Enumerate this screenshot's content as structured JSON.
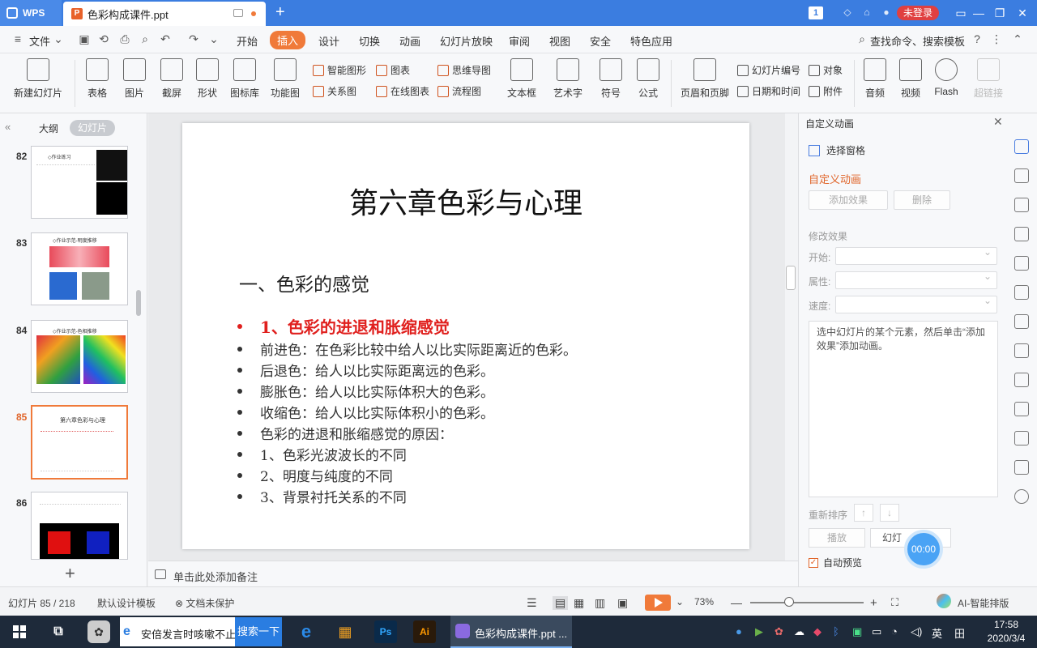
{
  "titlebar": {
    "app_tab": "WPS",
    "doc_tab": "色彩构成课件.ppt",
    "new_tab": "+",
    "page_badge": "1",
    "login": "未登录"
  },
  "menubar": {
    "file": "文件",
    "items": [
      "开始",
      "插入",
      "设计",
      "切换",
      "动画",
      "幻灯片放映",
      "审阅",
      "视图",
      "安全",
      "特色应用"
    ],
    "search": "查找命令、搜索模板"
  },
  "ribbon": {
    "new_slide": "新建幻灯片",
    "table": "表格",
    "picture": "图片",
    "screenshot": "截屏",
    "shape": "形状",
    "icon_lib": "图标库",
    "func_chart": "功能图",
    "smart_shape": "智能图形",
    "chart": "图表",
    "mind_map": "思维导图",
    "relation": "关系图",
    "online_chart": "在线图表",
    "flowchart": "流程图",
    "textbox": "文本框",
    "wordart": "艺术字",
    "symbol": "符号",
    "formula": "公式",
    "header_footer": "页眉和页脚",
    "slide_number": "幻灯片编号",
    "object": "对象",
    "datetime": "日期和时间",
    "attachment": "附件",
    "audio": "音频",
    "video": "视频",
    "flash": "Flash",
    "hyperlink": "超链接"
  },
  "left_panel": {
    "outline_tab": "大纲",
    "slides_tab": "幻灯片",
    "thumbs": [
      {
        "num": "82",
        "caption": "◇作业练习"
      },
      {
        "num": "83",
        "caption": "◇作业示范-明度推移"
      },
      {
        "num": "84",
        "caption": "◇作业示范-色相推移"
      },
      {
        "num": "85",
        "caption": "第六章色彩与心理"
      },
      {
        "num": "86",
        "caption": ""
      }
    ]
  },
  "slide": {
    "title": "第六章色彩与心理",
    "subtitle": "一、色彩的感觉",
    "bullets": [
      "1、色彩的进退和胀缩感觉",
      "前进色：在色彩比较中给人以比实际距离近的色彩。",
      "后退色：给人以比实际距离远的色彩。",
      "膨胀色：给人以比实际体积大的色彩。",
      "收缩色：给人以比实际体积小的色彩。",
      "色彩的进退和胀缩感觉的原因：",
      "1、色彩光波波长的不同",
      "2、明度与纯度的不同",
      "3、背景衬托关系的不同"
    ]
  },
  "notes": {
    "placeholder": "单击此处添加备注"
  },
  "right_panel": {
    "title": "自定义动画",
    "select_pane": "选择窗格",
    "custom_anim": "自定义动画",
    "add_effect": "添加效果",
    "delete": "删除",
    "modify": "修改效果",
    "start_label": "开始:",
    "property_label": "属性:",
    "speed_label": "速度:",
    "hint": "选中幻灯片的某个元素，然后单击“添加效果”添加动画。",
    "reorder": "重新排序",
    "play": "播放",
    "slideshow": "幻灯",
    "auto_preview": "自动预览",
    "timer": "00:00"
  },
  "statusbar": {
    "slide_count": "幻灯片 85 / 218",
    "template": "默认设计模板",
    "protect": "文档未保护",
    "zoom": "73%",
    "ai": "AI-智能排版"
  },
  "taskbar": {
    "search_text": "安倍发言时咳嗽不止",
    "search_btn": "搜索一下",
    "active_app": "色彩构成课件.ppt ...",
    "lang": "英",
    "time": "17:58",
    "date": "2020/3/4"
  }
}
